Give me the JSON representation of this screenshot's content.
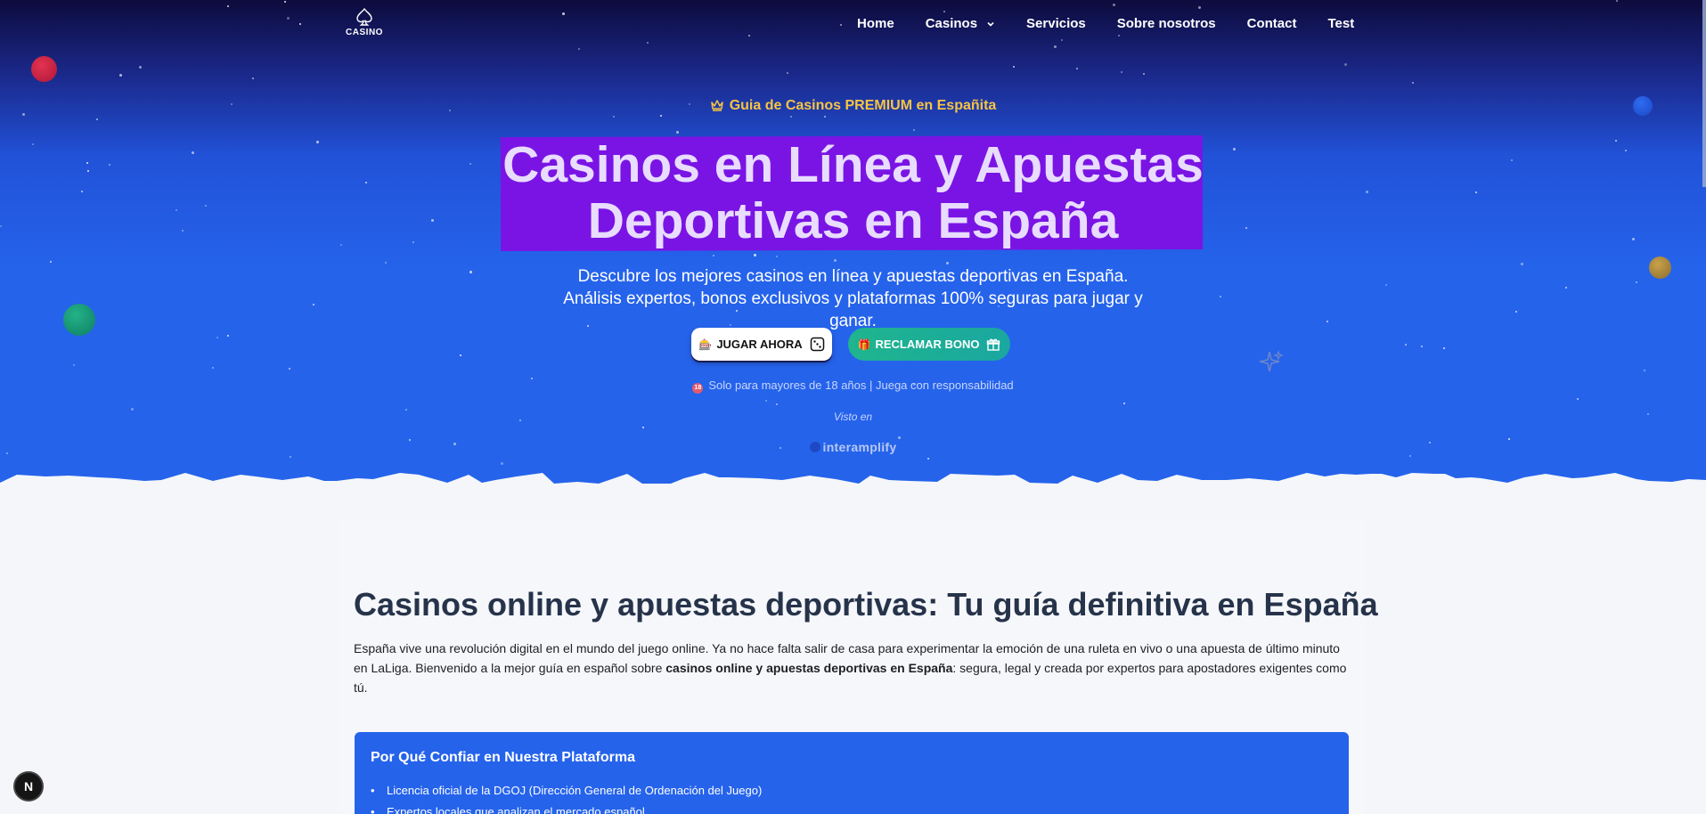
{
  "nav": {
    "logo_text": "CASINO",
    "items": [
      {
        "label": "Home"
      },
      {
        "label": "Casinos",
        "has_dropdown": true
      },
      {
        "label": "Servicios"
      },
      {
        "label": "Sobre nosotros"
      },
      {
        "label": "Contact"
      },
      {
        "label": "Test"
      }
    ]
  },
  "hero": {
    "tagline": "Guia de Casinos PREMIUM en Españita",
    "title_line1": "Casinos en Línea y Apuestas",
    "title_line2": "Deportivas en España",
    "subtitle": "Descubre los mejores casinos en línea y apuestas deportivas en España. Análisis expertos, bonos exclusivos y plataformas 100% seguras para jugar y ganar.",
    "play_button": "JUGAR AHORA",
    "bonus_button": "RECLAMAR BONO",
    "age_notice": "Solo para mayores de 18 años | Juega con responsabilidad",
    "seen_in": "Visto en",
    "brand": "interamplify"
  },
  "content": {
    "heading": "Casinos online y apuestas deportivas: Tu guía definitiva en España",
    "para_before": "España vive una revolución digital en el mundo del juego online. Ya no hace falta salir de casa para experimentar la emoción de una ruleta en vivo o una apuesta de último minuto en LaLiga. Bienvenido a la mejor guía en español sobre ",
    "para_bold": "casinos online y apuestas deportivas en España",
    "para_after": ": segura, legal y creada por expertos para apostadores exigentes como tú.",
    "trust_title": "Por Qué Confiar en Nuestra Plataforma",
    "trust_items": [
      "Licencia oficial de la DGOJ (Dirección General de Ordenación del Juego)",
      "Expertos locales que analizan el mercado español"
    ]
  },
  "badge": "N",
  "colors": {
    "hero_top": "#0d0b3d",
    "hero_main": "#2563eb",
    "title_highlight": "#7a14e4",
    "tagline": "#f6c443",
    "bonus_button": "#1fb58e",
    "trust_box": "#2563eb",
    "heading": "#26334a"
  }
}
